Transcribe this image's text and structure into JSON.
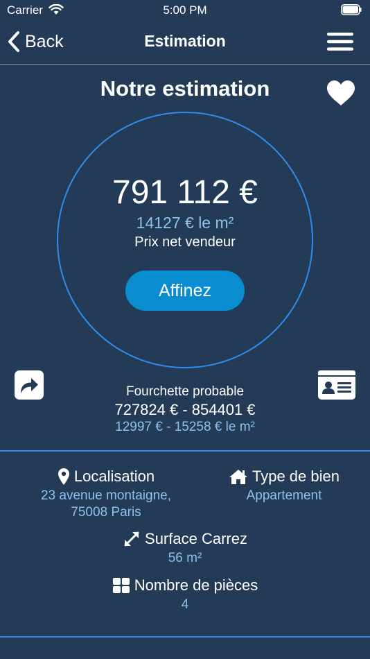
{
  "status_bar": {
    "carrier": "Carrier",
    "time": "5:00 PM"
  },
  "nav": {
    "back_label": "Back",
    "title": "Estimation"
  },
  "heading": "Notre estimation",
  "estimate": {
    "price": "791 112 €",
    "price_per_m2": "14127 € le m²",
    "label": "Prix net vendeur",
    "refine_label": "Affinez"
  },
  "range": {
    "label": "Fourchette probable",
    "price": "727824 € - 854401 €",
    "per_m2": "12997 € - 15258 € le m²"
  },
  "details": {
    "location": {
      "title": "Localisation",
      "line1": "23 avenue montaigne,",
      "line2": "75008 Paris"
    },
    "type": {
      "title": "Type de bien",
      "value": "Appartement"
    },
    "surface": {
      "title": "Surface Carrez",
      "value": "56 m²"
    },
    "rooms": {
      "title": "Nombre de pièces",
      "value": "4"
    }
  },
  "icons": {
    "back": "chevron-left-icon",
    "menu": "hamburger-menu-icon",
    "favorite": "heart-icon",
    "share": "share-icon",
    "card": "id-card-icon",
    "location": "map-pin-icon",
    "type": "home-icon",
    "surface": "expand-arrows-icon",
    "rooms": "grid-icon"
  },
  "colors": {
    "background": "#243b58",
    "accent_blue": "#2f8dea",
    "button_blue": "#0a8dd0",
    "secondary_text": "#8fc1ec"
  }
}
